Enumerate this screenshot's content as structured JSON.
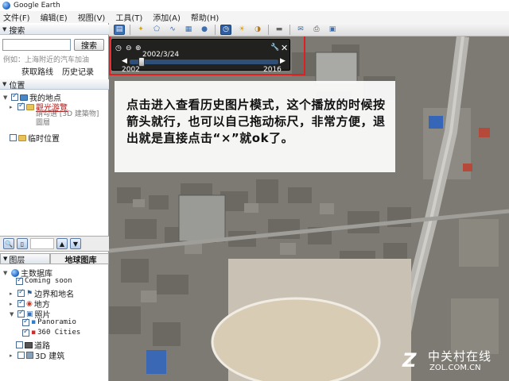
{
  "window": {
    "title": "Google Earth"
  },
  "menu": [
    "文件(F)",
    "编辑(E)",
    "视图(V)",
    "工具(T)",
    "添加(A)",
    "帮助(H)"
  ],
  "search": {
    "section_label": "搜索",
    "placeholder": "",
    "button_label": "搜索",
    "hint": "例如：上海附近的汽车加油",
    "links": [
      "获取路线",
      "历史记录"
    ]
  },
  "places": {
    "section_label": "位置",
    "my_places": "我的地点",
    "tour_label": "觀光游覽",
    "tour_note": "請勾選 [3D 建築物] 圖層",
    "temp_places": "临时位置"
  },
  "layers": {
    "tab_layers": "图层",
    "tab_gallery": "地球图库",
    "items": [
      {
        "label": "主数据库",
        "checked": true,
        "icon": "globe-icon"
      },
      {
        "label": "Coming soon",
        "checked": true,
        "icon": "none"
      },
      {
        "label": "边界和地名",
        "checked": true,
        "icon": "flag-icon"
      },
      {
        "label": "地方",
        "checked": true,
        "icon": "place-icon"
      },
      {
        "label": "照片",
        "checked": true,
        "icon": "photo-icon"
      },
      {
        "label": "Panoramio",
        "checked": true,
        "icon": "panoramio-icon"
      },
      {
        "label": "360 Cities",
        "checked": true,
        "icon": "cities-icon"
      },
      {
        "label": "道路",
        "checked": false,
        "icon": "road-icon"
      },
      {
        "label": "3D 建筑",
        "checked": false,
        "icon": "building-icon"
      }
    ]
  },
  "time_slider": {
    "current_date": "2002/3/24",
    "start_year": "2002",
    "end_year": "2016",
    "position": 0.08
  },
  "caption": {
    "text": "点击进入查看历史图片模式，这个播放的时候按箭头就行，也可以自己拖动标尺，非常方便，退出就是直接点击“×”就ok了。"
  },
  "watermark": {
    "main": "中关村在线",
    "sub": "ZOL.COM.CN"
  },
  "colors": {
    "highlight_red": "#e02020",
    "tree_link_red": "#b81d1d",
    "caption_bg": "#ffffff"
  }
}
